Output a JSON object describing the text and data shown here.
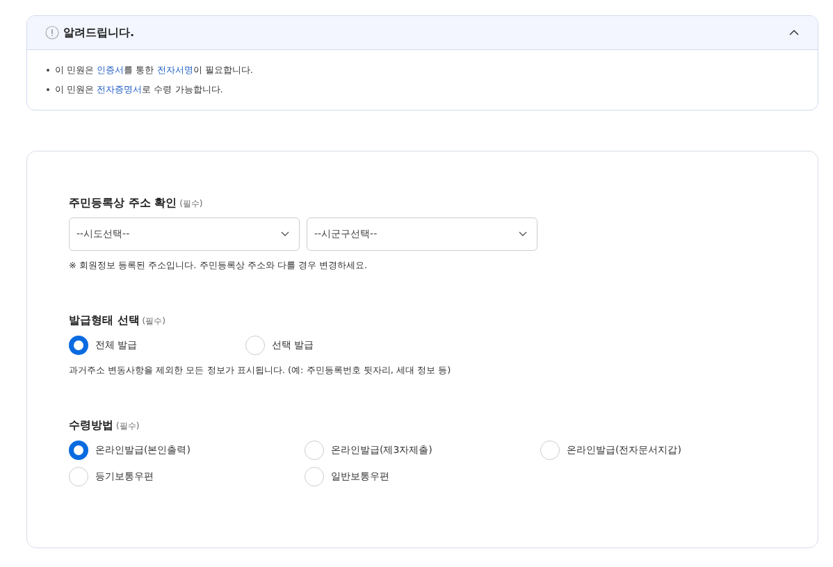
{
  "notice": {
    "title": "알려드립니다.",
    "expanded": true,
    "items": [
      [
        {
          "text": "이 민원은 ",
          "highlight": false
        },
        {
          "text": "인증서",
          "highlight": true
        },
        {
          "text": "를 통한 ",
          "highlight": false
        },
        {
          "text": "전자서명",
          "highlight": true
        },
        {
          "text": "이 필요합니다.",
          "highlight": false
        }
      ],
      [
        {
          "text": "이 민원은 ",
          "highlight": false
        },
        {
          "text": "전자증명서",
          "highlight": true
        },
        {
          "text": "로 수령 가능합니다.",
          "highlight": false
        }
      ]
    ]
  },
  "sections": [
    {
      "kind": "selects",
      "title": "주민등록상 주소 확인",
      "required": "(필수)",
      "selects": [
        {
          "placeholder": "--시도선택--"
        },
        {
          "placeholder": "--시군구선택--"
        }
      ],
      "help": "※ 회원정보 등록된 주소입니다. 주민등록상 주소와 다를 경우 변경하세요."
    },
    {
      "kind": "radios",
      "title": "발급형태 선택",
      "required": "(필수)",
      "options": [
        {
          "label": "전체 발급",
          "selected": true
        },
        {
          "label": "선택 발급",
          "selected": false
        }
      ],
      "help": "과거주소 변동사항을 제외한 모든 정보가 표시됩니다. (예: 주민등록번호 뒷자리, 세대 정보 등)"
    },
    {
      "kind": "radios",
      "title": "수령방법",
      "required": "(필수)",
      "options": [
        {
          "label": "온라인발급(본인출력)",
          "selected": true
        },
        {
          "label": "온라인발급(제3자제출)",
          "selected": false
        },
        {
          "label": "온라인발급(전자문서지갑)",
          "selected": false
        },
        {
          "label": "등기보통우편",
          "selected": false
        },
        {
          "label": "일반보통우편",
          "selected": false
        }
      ]
    }
  ]
}
